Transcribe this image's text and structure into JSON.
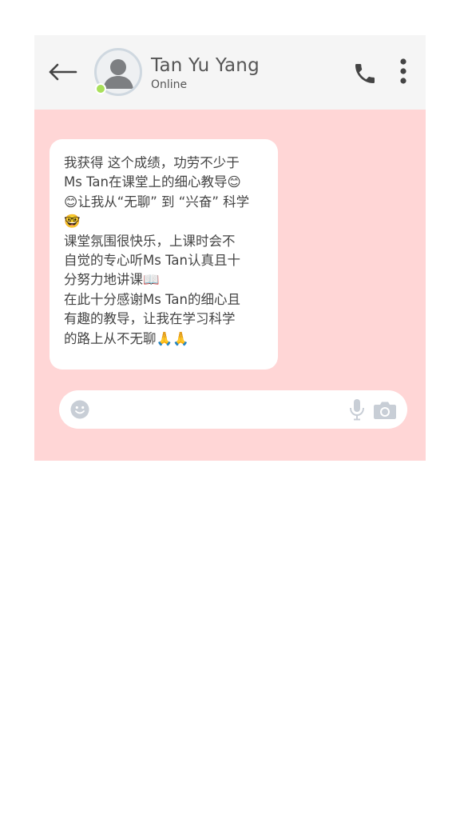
{
  "header": {
    "contact_name": "Tan Yu Yang",
    "status": "Online",
    "back_icon": "arrow-left-icon",
    "call_icon": "phone-icon",
    "more_icon": "more-vertical-icon"
  },
  "messages": [
    {
      "lines": [
        "我获得 这个成绩，功劳不少于",
        "Ms Tan在课堂上的细心教导😊",
        "😊让我从“无聊” 到 “兴奋” 科学",
        "🤓",
        "课堂氛围很快乐，上课时会不",
        "自觉的专心听Ms Tan认真且十",
        "分努力地讲课📖",
        "在此十分感谢Ms Tan的细心且",
        "有趣的教导，让我在学习科学",
        "的路上从不无聊🙏🙏"
      ]
    }
  ],
  "composer": {
    "placeholder": "",
    "value": "",
    "emoji_icon": "smiley-icon",
    "mic_icon": "microphone-icon",
    "camera_icon": "camera-icon"
  },
  "colors": {
    "chat_background": "#ffd6d6",
    "header_background": "#f5f5f5",
    "bubble_background": "#ffffff",
    "presence": "#a9e05a",
    "icon_dark": "#444444",
    "icon_light": "#c8ced6"
  }
}
